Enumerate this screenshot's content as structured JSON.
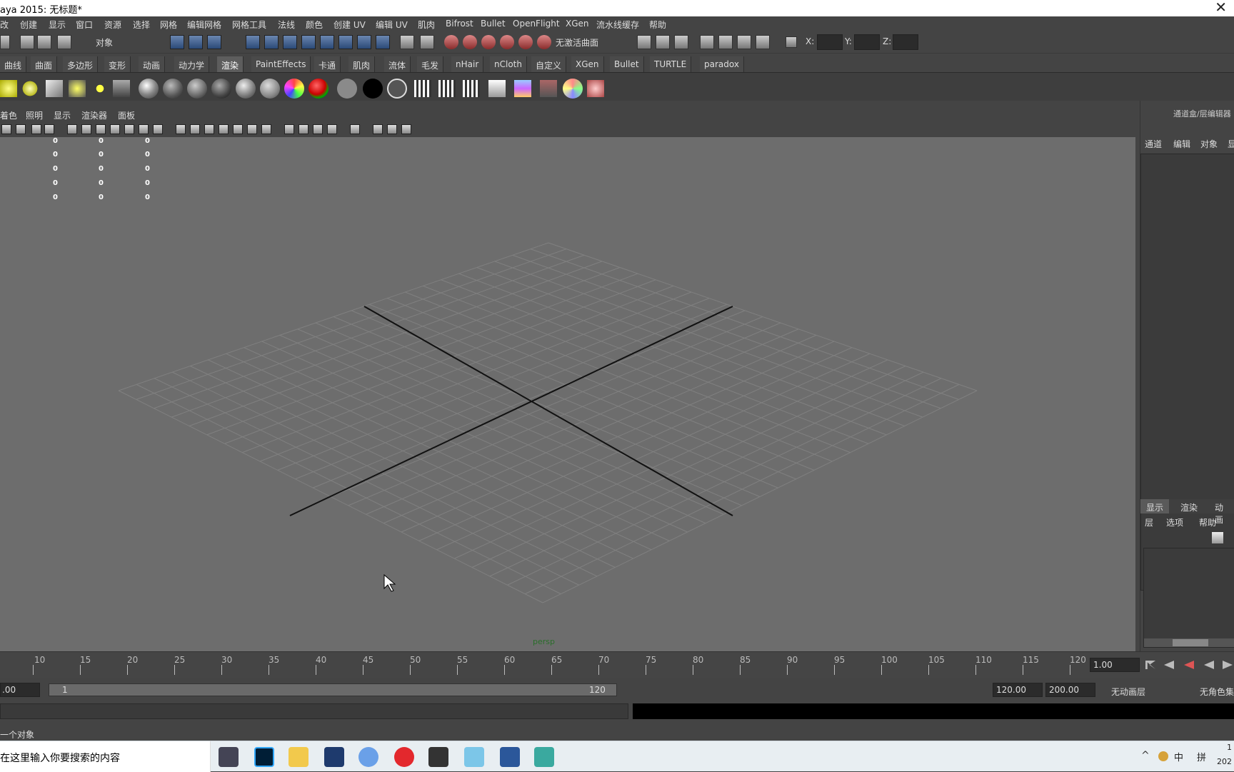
{
  "window": {
    "title": "aya 2015: 无标题*",
    "close_glyph": "✕"
  },
  "menubar": [
    "改",
    "创建",
    "显示",
    "窗口",
    "资源",
    "选择",
    "网格",
    "编辑网格",
    "网格工具",
    "法线",
    "颜色",
    "创建 UV",
    "编辑 UV",
    "肌肉",
    "Bifrost",
    "Bullet",
    "OpenFlight",
    "XGen",
    "流水线缓存",
    "帮助"
  ],
  "statusline": {
    "select_mode": "对象",
    "surface_field": "无激活曲面",
    "x_label": "X:",
    "y_label": "Y:",
    "z_label": "Z:"
  },
  "shelf_tabs": [
    "曲线",
    "曲面",
    "多边形",
    "变形",
    "动画",
    "动力学",
    "渲染",
    "PaintEffects",
    "卡通",
    "肌肉",
    "流体",
    "毛发",
    "nHair",
    "nCloth",
    "自定义",
    "XGen",
    "Bullet",
    "TURTLE",
    "paradox"
  ],
  "shelf_active_tab": "渲染",
  "panel_menu": [
    "着色",
    "照明",
    "显示",
    "渲染器",
    "面板"
  ],
  "hud_values": [
    "0",
    "0",
    "0",
    "0",
    "0",
    "0",
    "0",
    "0",
    "0",
    "0",
    "0",
    "0",
    "0",
    "0",
    "0"
  ],
  "viewport": {
    "camera_label": "persp"
  },
  "right_panel": {
    "title": "通道盒/层编辑器",
    "menu": [
      "通道",
      "编辑",
      "对象",
      "显"
    ],
    "layer_tabs": [
      "显示",
      "渲染",
      "动画"
    ],
    "layer_menu": [
      "层",
      "选项",
      "帮助"
    ]
  },
  "timeline": {
    "ticks": [
      "10",
      "15",
      "20",
      "25",
      "30",
      "35",
      "40",
      "45",
      "50",
      "55",
      "60",
      "65",
      "70",
      "75",
      "80",
      "85",
      "90",
      "95",
      "100",
      "105",
      "110",
      "115",
      "120"
    ],
    "current_frame": "1.00"
  },
  "range": {
    "start": ".00",
    "range_start": "1",
    "range_end": "120",
    "end": "120.00",
    "max": "200.00",
    "anim_layer": "无动画层",
    "char_set": "无角色集"
  },
  "help_line": "一个对象",
  "taskbar": {
    "search_placeholder": "在这里输入你要搜索的内容",
    "tray_ime": "中",
    "tray_ime2": "拼",
    "clock_time": "1",
    "clock_date": "202"
  },
  "colors": {
    "viewport": "#6d6d6d",
    "ui_bg": "#444444",
    "accent": "#5d5d5d"
  }
}
